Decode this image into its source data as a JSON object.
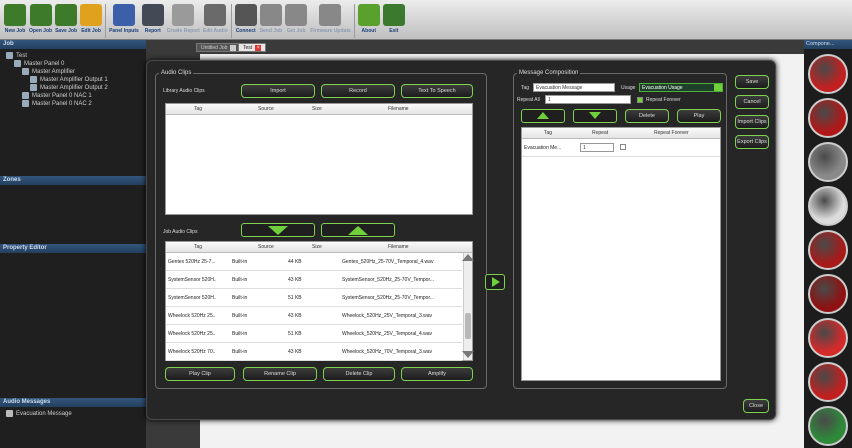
{
  "toolbar": {
    "buttons": [
      {
        "label": "New Job",
        "enabled": true,
        "icon": "new-job-icon",
        "color": "#3d7a2a"
      },
      {
        "label": "Open Job",
        "enabled": true,
        "icon": "open-folder-icon",
        "color": "#3d7a2a"
      },
      {
        "label": "Save Job",
        "enabled": true,
        "icon": "save-folder-icon",
        "color": "#3d7a2a"
      },
      {
        "label": "Edit Job",
        "enabled": true,
        "icon": "pencil-icon",
        "color": "#e0a21c"
      },
      {
        "label": "Panel Inputs",
        "enabled": true,
        "icon": "panel-inputs-icon",
        "color": "#3b5fa8"
      },
      {
        "label": "Report",
        "enabled": true,
        "icon": "report-icon",
        "color": "#444a55"
      },
      {
        "label": "Create Report",
        "enabled": false,
        "icon": "hammer-icon",
        "color": "#9a9a9a"
      },
      {
        "label": "Edit Audio",
        "enabled": false,
        "icon": "edit-audio-icon",
        "color": "#6a6a6a"
      },
      {
        "label": "Connect",
        "enabled": true,
        "icon": "plug-icon",
        "color": "#555555"
      },
      {
        "label": "Send Job",
        "enabled": false,
        "icon": "send-job-icon",
        "color": "#888888"
      },
      {
        "label": "Get Job",
        "enabled": false,
        "icon": "get-job-icon",
        "color": "#888888"
      },
      {
        "label": "Firmware Update",
        "enabled": false,
        "icon": "firmware-icon",
        "color": "#888888"
      },
      {
        "label": "About",
        "enabled": true,
        "icon": "info-icon",
        "color": "#5aa02c"
      },
      {
        "label": "Exit",
        "enabled": true,
        "icon": "exit-icon",
        "color": "#3b7a2e"
      }
    ]
  },
  "left_panel": {
    "job_header": "Job",
    "tree": [
      {
        "label": "Test",
        "icon": "job-node-icon"
      },
      {
        "label": "Master Panel 0",
        "icon": "panel-icon"
      },
      {
        "label": "Master Amplifier",
        "icon": "amplifier-icon"
      },
      {
        "label": "Master Amplifier Output 1",
        "icon": "output-icon"
      },
      {
        "label": "Master Amplifier Output 2",
        "icon": "output-icon"
      },
      {
        "label": "Master Panel 0 NAC 1",
        "icon": "nac-icon"
      },
      {
        "label": "Master Panel 0 NAC 2",
        "icon": "nac-icon"
      }
    ],
    "zones_header": "Zones",
    "property_header": "Property Editor",
    "audio_messages_header": "Audio Messages",
    "audio_messages": [
      "Evacuation Message"
    ]
  },
  "doc_tabs": [
    {
      "label": "Untitled Job",
      "active": false
    },
    {
      "label": "Test",
      "active": true
    }
  ],
  "dialog": {
    "audio_clips_title": "Audio Clips",
    "library_label": "Library Audio Clips",
    "import_label": "Import",
    "record_label": "Record",
    "tts_label": "Text To Speech",
    "library_columns": [
      "Tag",
      "Source",
      "Size",
      "Filename"
    ],
    "job_clips_label": "Job Audio Clips",
    "job_columns": [
      "Tag",
      "Source",
      "Size",
      "Filename"
    ],
    "job_rows": [
      {
        "tag": "Gentex 520Hz 25-7...",
        "source": "Built-in",
        "size": "44 KB",
        "filename": "Gentex_520Hz_25-70V_Temporal_4.wav"
      },
      {
        "tag": "SystemSensor 520H...",
        "source": "Built-in",
        "size": "43 KB",
        "filename": "SystemSensor_520Hz_25-70V_Tempor..."
      },
      {
        "tag": "SystemSensor 520H...",
        "source": "Built-in",
        "size": "51 KB",
        "filename": "SystemSensor_520Hz_25-70V_Tempor..."
      },
      {
        "tag": "Wheelock 520Hz 25...",
        "source": "Built-in",
        "size": "43 KB",
        "filename": "Wheelock_520Hz_25V_Temporal_3.wav"
      },
      {
        "tag": "Wheelock 520Hz 25...",
        "source": "Built-in",
        "size": "51 KB",
        "filename": "Wheelock_520Hz_25V_Temporal_4.wav"
      },
      {
        "tag": "Wheelock 520Hz 70...",
        "source": "Built-in",
        "size": "43 KB",
        "filename": "Wheelock_520Hz_70V_Temporal_3.wav"
      }
    ],
    "play_clip_label": "Play Clip",
    "rename_clip_label": "Rename Clip",
    "delete_clip_label": "Delete Clip",
    "amplify_label": "Amplify",
    "composition_title": "Message Composition",
    "tag_label": "Tag",
    "tag_value": "Evacuation Message",
    "usage_label": "Usage",
    "usage_value": "Evacuation Usage",
    "repeat_all_label": "Repeat All",
    "repeat_all_value": "1",
    "repeat_forever_label": "Repeat Forever",
    "delete_label": "Delete",
    "play_label": "Play",
    "comp_columns": [
      "Tag",
      "Repeat",
      "Repeat Forever"
    ],
    "comp_rows": [
      {
        "tag": "Evacuation Me...",
        "repeat": "1"
      }
    ],
    "save_label": "Save",
    "cancel_label": "Cancel",
    "import_clips_label": "Import Clips",
    "export_clips_label": "Export Clips",
    "close_label": "Close"
  },
  "right_panel": {
    "header": "Compone...",
    "components": [
      {
        "icon": "red-horn-strobe-icon",
        "color": "#c22020"
      },
      {
        "icon": "red-speaker-grille-icon",
        "color": "#b01818"
      },
      {
        "icon": "grey-speaker-icon",
        "color": "#8a8a8a"
      },
      {
        "icon": "white-speaker-icon",
        "color": "#dcdcdc"
      },
      {
        "icon": "red-square-speaker-icon",
        "color": "#a81a1a"
      },
      {
        "icon": "red-box-speaker-icon",
        "color": "#8e1212"
      },
      {
        "icon": "red-dome-strobe-icon",
        "color": "#d42a2a"
      },
      {
        "icon": "red-ceiling-speaker-icon",
        "color": "#c02020"
      },
      {
        "icon": "green-device-icon",
        "color": "#2e8a3a"
      }
    ]
  }
}
